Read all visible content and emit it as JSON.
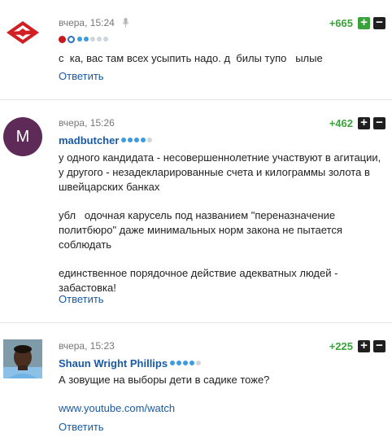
{
  "comments": [
    {
      "avatar": "spartak-logo",
      "time": "вчера, 15:24",
      "has_voice_icon": true,
      "username": "",
      "rating_dots": 5,
      "rating_filled": 2,
      "score": "+665",
      "up_label": "+",
      "down_label": "−",
      "text": [
        "с  ка, вас там всех усыпить надо. д  билы тупо   ылые"
      ],
      "reply": "Ответить"
    },
    {
      "avatar": "letter-avatar",
      "avatar_letter": "M",
      "time": "вчера, 15:26",
      "username": "madbutcher",
      "rating_dots": 5,
      "rating_filled": 4,
      "score": "+462",
      "up_label": "+",
      "down_label": "−",
      "text": [
        "у одного кандидата - несовершеннолетние участвуют в агитации, у другого - незадекларированные счета и килограммы золота в швейцарских банках",
        "убл   одочная карусель под названием \"переназначение политбюро\" даже минимальных норм закона не пытается соблюдать",
        "единственное порядочное действие адекватных людей - забастовка!"
      ],
      "reply": "Ответить"
    },
    {
      "avatar": "photo-avatar",
      "time": "вчера, 15:23",
      "username": "Shaun Wright Phillips",
      "rating_dots": 5,
      "rating_filled": 4,
      "score": "+225",
      "up_label": "+",
      "down_label": "−",
      "text": [
        "А зовущие на выборы дети в садике тоже?"
      ],
      "link": "www.youtube.com/watch",
      "reply": "Ответить"
    }
  ],
  "colors": {
    "score_positive": "#3aa23a",
    "link": "#1a5aa3",
    "rating_dot_on": "#3d9be0",
    "rating_dot_off": "#cfd5dc"
  }
}
